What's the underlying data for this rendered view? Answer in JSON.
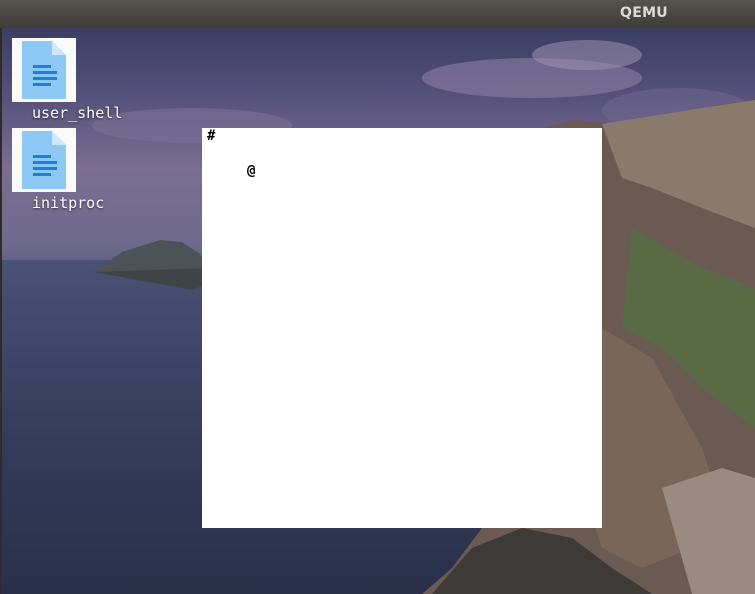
{
  "window": {
    "title": "QEMU"
  },
  "desktop": {
    "icons": [
      {
        "label": "user_shell",
        "icon": "text-document-icon"
      },
      {
        "label": "initproc",
        "icon": "text-document-icon"
      }
    ]
  },
  "vm_screen": {
    "prompt": "#",
    "cursor_glyph": "@"
  },
  "colors": {
    "titlebar": "#4a4844",
    "title_text": "#dfdbd2",
    "doc_icon_blue": "#8ec9f5",
    "doc_icon_lines": "#1e7fd8",
    "screen_bg": "#ffffff"
  }
}
